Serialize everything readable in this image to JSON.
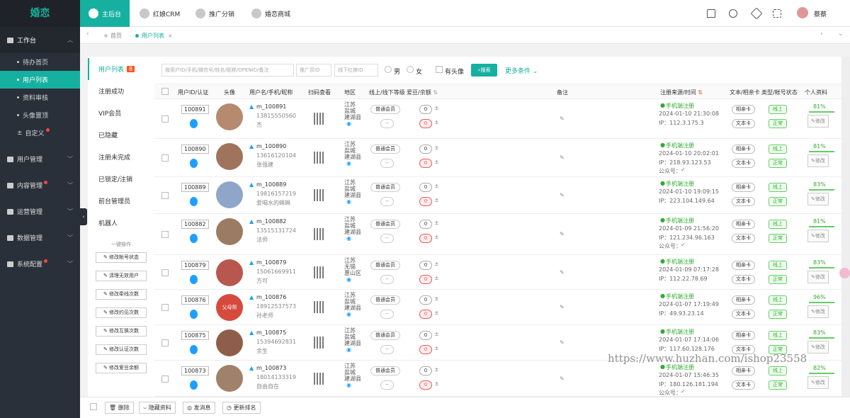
{
  "brand": "婚恋",
  "sidebar": {
    "groups": [
      {
        "label": "工作台",
        "open": true
      },
      {
        "label": "用户管理"
      },
      {
        "label": "内容管理",
        "dot": true
      },
      {
        "label": "运营管理"
      },
      {
        "label": "数据管理"
      },
      {
        "label": "系统配置",
        "dot": true
      }
    ],
    "sub": [
      "待办首页",
      "用户列表",
      "资料审核",
      "头像置顶",
      "自定义"
    ]
  },
  "topnav": {
    "tabs": [
      "主后台",
      "红娘CRM",
      "推广分销",
      "婚恋商城"
    ],
    "user": "蔡蔡"
  },
  "pagetabs": [
    "首页",
    "用户列表"
  ],
  "leftmenu": {
    "items": [
      "用户列表",
      "注册成功",
      "VIP会员",
      "已隐藏",
      "注册未完成",
      "已锁定/注销",
      "前台管理员",
      "机器人"
    ],
    "badge": "8",
    "onekey": "一键操作",
    "ops": [
      "修改帐号状态",
      "清理无效用户",
      "修改牵线次数",
      "修改约见次数",
      "修改互换次数",
      "修改认证次数",
      "修改爱豆余额"
    ]
  },
  "filter": {
    "search_ph": "按用户ID/手机/微信号/姓名/昵称/OPENID/备注",
    "promo_ph": "推广员ID",
    "offline_ph": "线下红娘ID",
    "male": "男",
    "female": "女",
    "has_avatar": "有头像",
    "search_btn": "搜索",
    "more": "更多条件"
  },
  "columns": [
    "用户ID/认证",
    "头像",
    "用户名/手机/昵称",
    "扫码查看",
    "地区",
    "线上/线下等级",
    "爱豆/余额",
    "备注",
    "注册来源/时间",
    "文本/相亲卡",
    "类型/帐号状态",
    "个人资料"
  ],
  "rows": [
    {
      "id": "100891",
      "user": "m_100891",
      "phone": "13815550560",
      "nick": "杰",
      "region": [
        "江苏",
        "盐城",
        "建湖县"
      ],
      "level": "普通会员",
      "level2": "--",
      "dou": "0",
      "bal": "0",
      "src": "手机端注册",
      "time": "2024-01-10 21:30:08",
      "ip": "IP：112.3.175.3",
      "gzh": "",
      "pct": "81%"
    },
    {
      "id": "100890",
      "user": "m_100890",
      "phone": "13616120104",
      "nick": "张强建",
      "region": [
        "江苏",
        "盐城",
        "建湖县"
      ],
      "level": "普通会员",
      "level2": "--",
      "dou": "0",
      "bal": "0",
      "src": "手机端注册",
      "time": "2024-01-10 20:02:01",
      "ip": "IP：218.93.123.53",
      "gzh": "公众号：",
      "pct": "81%"
    },
    {
      "id": "100889",
      "user": "m_100889",
      "phone": "19816157219",
      "nick": "爱喝水的蝌蝌",
      "region": [
        "江苏",
        "盐城",
        "建湖县"
      ],
      "level": "普通会员",
      "level2": "--",
      "dou": "0",
      "bal": "0",
      "src": "手机端注册",
      "time": "2024-01-10 19:09:15",
      "ip": "IP：223.104.149.64",
      "gzh": "",
      "pct": "83%"
    },
    {
      "id": "100882",
      "user": "m_100882",
      "phone": "13515131724",
      "nick": "法师",
      "region": [
        "江苏",
        "盐城",
        "建湖县"
      ],
      "level": "普通会员",
      "level2": "--",
      "dou": "0",
      "bal": "0",
      "src": "手机端注册",
      "time": "2024-01-09 21:56:20",
      "ip": "IP：121.234.96.163",
      "gzh": "公众号：",
      "pct": "81%"
    },
    {
      "id": "100879",
      "user": "m_100879",
      "phone": "15061669911",
      "nick": "方可",
      "region": [
        "江苏",
        "无锡",
        "惠山区"
      ],
      "level": "普通会员",
      "level2": "--",
      "dou": "0",
      "bal": "0",
      "src": "手机端注册",
      "time": "2024-01-09 07:17:28",
      "ip": "IP：112.22.78.69",
      "gzh": "",
      "pct": "83%"
    },
    {
      "id": "100876",
      "user": "m_100876",
      "phone": "18912537573",
      "nick": "孙老师",
      "region": [
        "江苏",
        "盐城",
        "建湖县"
      ],
      "level": "普通会员",
      "level2": "--",
      "dou": "0",
      "bal": "0",
      "src": "手机端注册",
      "time": "2024-01-07 17:19:49",
      "ip": "IP：49.93.23.14",
      "gzh": "",
      "pct": "96%"
    },
    {
      "id": "100875",
      "user": "m_100875",
      "phone": "15394692831",
      "nick": "余生",
      "region": [
        "江苏",
        "盐城",
        "建湖县"
      ],
      "level": "普通会员",
      "level2": "--",
      "dou": "0",
      "bal": "0",
      "src": "手机端注册",
      "time": "2024-01-07 17:14:06",
      "ip": "IP：117.60.128.176",
      "gzh": "",
      "pct": "83%"
    },
    {
      "id": "100873",
      "user": "m_100873",
      "phone": "18014133319",
      "nick": "自由自在",
      "region": [
        "江苏",
        "盐城",
        "建湖县"
      ],
      "level": "普通会员",
      "level2": "--",
      "dou": "0",
      "bal": "0",
      "src": "手机端注册",
      "time": "2024-01-07 15:46:35",
      "ip": "IP：180.126.181.194",
      "gzh": "公众号：",
      "pct": "82%"
    }
  ],
  "row_labels": {
    "text_card": "文本卡",
    "match_card": "相亲卡",
    "online": "线上",
    "normal": "正常",
    "modify": "修改",
    "fumu": "父母帮"
  },
  "footer": {
    "delete": "删除",
    "hide": "隐藏资料",
    "msg": "发消息",
    "rank": "更新排名"
  },
  "watermark": "https://www.huzhan.com/ishop23558"
}
